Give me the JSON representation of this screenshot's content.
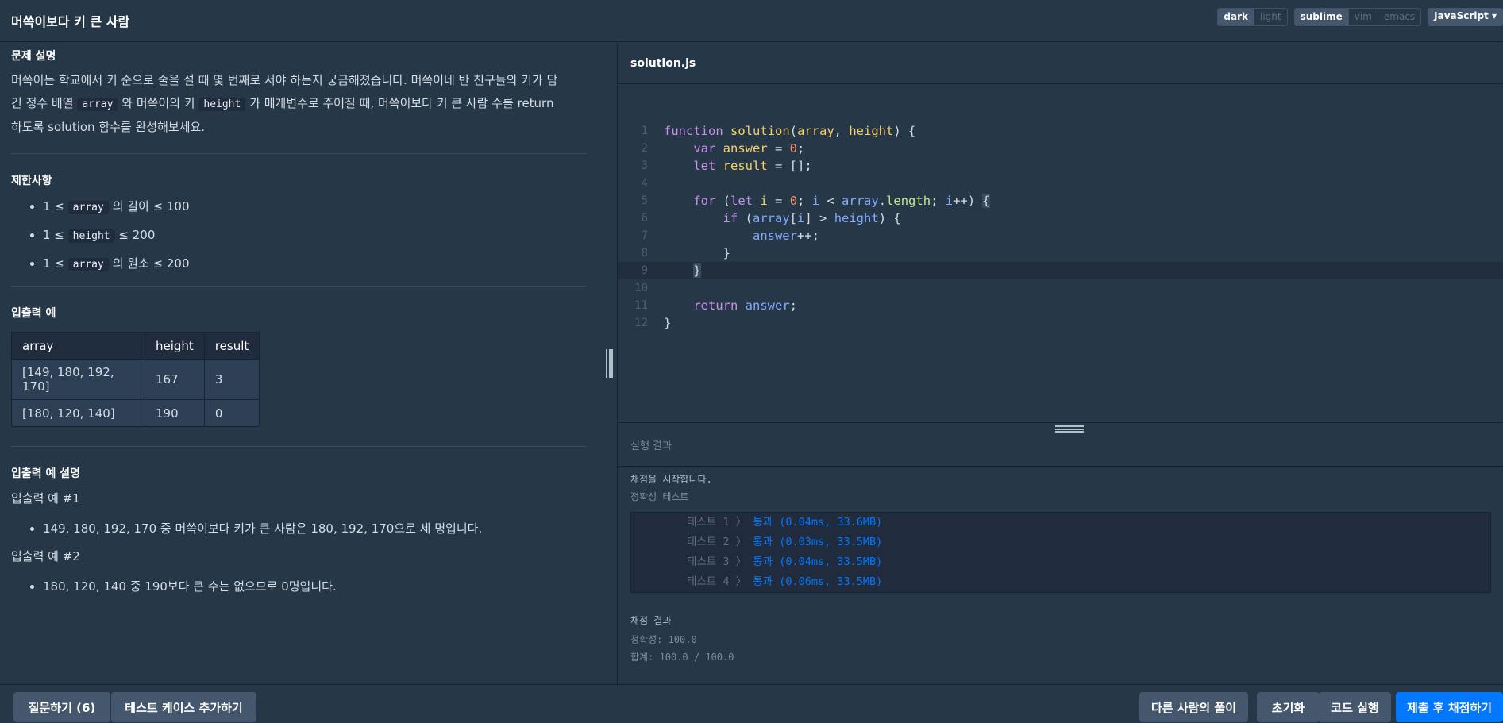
{
  "header": {
    "title": "머쓱이보다 키 큰 사람",
    "theme_options": [
      "dark",
      "light"
    ],
    "theme_selected": "dark",
    "keymap_options": [
      "sublime",
      "vim",
      "emacs"
    ],
    "keymap_selected": "sublime",
    "language": "JavaScript"
  },
  "problem": {
    "section_description": "문제 설명",
    "desc_part1": "머쓱이는 학교에서 키 순으로 줄을 설 때 몇 번째로 서야 하는지 궁금해졌습니다. 머쓱이네 반 친구들의 키가 담",
    "desc_part2a": "긴 정수 배열",
    "desc_code1": "array",
    "desc_part2b": "와 머쓱이의 키",
    "desc_code2": "height",
    "desc_part2c": "가 매개변수로 주어질 때, 머쓱이보다 키 큰 사람 수를 return",
    "desc_part3": "하도록 solution 함수를 완성해보세요.",
    "section_constraints": "제한사항",
    "constraints": [
      {
        "prefix": "1 ≤",
        "code": "array",
        "suffix": "의 길이 ≤ 100"
      },
      {
        "prefix": "1 ≤",
        "code": "height",
        "suffix": "≤ 200"
      },
      {
        "prefix": "1 ≤",
        "code": "array",
        "suffix": "의 원소 ≤ 200"
      }
    ],
    "section_io": "입출력 예",
    "io_table": {
      "headers": [
        "array",
        "height",
        "result"
      ],
      "rows": [
        [
          "[149, 180, 192, 170]",
          "167",
          "3"
        ],
        [
          "[180, 120, 140]",
          "190",
          "0"
        ]
      ]
    },
    "section_io_explain": "입출력 예 설명",
    "example1_title": "입출력 예 #1",
    "example1_text": "149, 180, 192, 170 중 머쓱이보다 키가 큰 사람은 180, 192, 170으로 세 명입니다.",
    "example2_title": "입출력 예 #2",
    "example2_text": "180, 120, 140 중 190보다 큰 수는 없으므로 0명입니다."
  },
  "editor": {
    "filename": "solution.js",
    "line_numbers": [
      "1",
      "2",
      "3",
      "4",
      "5",
      "6",
      "7",
      "8",
      "9",
      "10",
      "11",
      "12"
    ],
    "code_lines": [
      "function solution(array, height) {",
      "    var answer = 0;",
      "    let result = [];",
      "",
      "    for (let i = 0; i < array.length; i++) {",
      "        if (array[i] > height) {",
      "            answer++;",
      "        }",
      "    }",
      "",
      "    return answer;",
      "}"
    ]
  },
  "result": {
    "title": "실행 결과",
    "start_message": "채점을 시작합니다.",
    "accuracy_test_label": "정확성  테스트",
    "tests": [
      {
        "name": "테스트 1",
        "result": "통과 (0.04ms, 33.6MB)"
      },
      {
        "name": "테스트 2",
        "result": "통과 (0.03ms, 33.5MB)"
      },
      {
        "name": "테스트 3",
        "result": "통과 (0.04ms, 33.5MB)"
      },
      {
        "name": "테스트 4",
        "result": "통과 (0.06ms, 33.5MB)"
      }
    ],
    "summary_title": "채점 결과",
    "accuracy": "정확성: 100.0",
    "total": "합계: 100.0 / 100.0"
  },
  "bottom": {
    "ask_button": "질문하기 (6)",
    "add_testcase_button": "테스트 케이스 추가하기",
    "others_solution_button": "다른 사람의 풀이",
    "reset_button": "초기화",
    "run_button": "코드 실행",
    "submit_button": "제출 후 채점하기"
  },
  "colors": {
    "background": "#263747",
    "panel_dark": "#202b3d",
    "button": "#44576c",
    "primary": "#0078ff"
  }
}
